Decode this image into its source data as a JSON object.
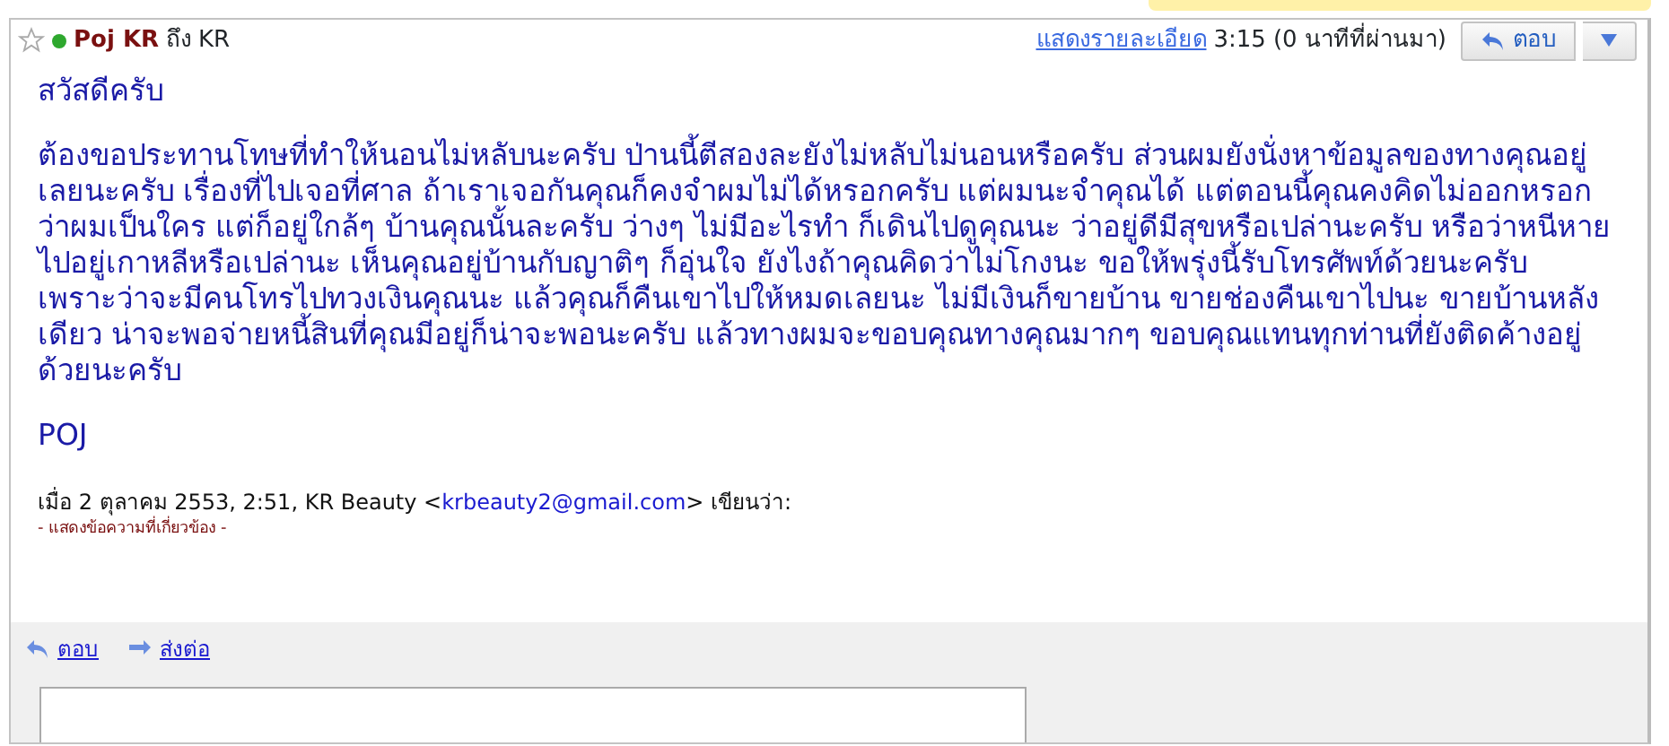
{
  "header": {
    "starred": false,
    "online": true,
    "sender": "Poj KR",
    "to_word": "ถึง",
    "recipient": "KR",
    "details_link": "แสดงรายละเอียด",
    "time": "3:15",
    "ago": "(0 นาทีที่ผ่านมา)",
    "reply_button": "ตอบ"
  },
  "message": {
    "greeting": "สวัสดีครับ",
    "body": "ต้องขอประทานโทษที่ทำให้นอนไม่หลับนะครับ ป่านนี้ตีสองละยังไม่หลับไม่นอนหรือครับ ส่วนผมยังนั่งหาข้อมูลของทางคุณอยู่เลยนะครับ เรื่องที่ไปเจอที่ศาล ถ้าเราเจอกันคุณก็คงจำผมไม่ได้หรอกครับ แต่ผมนะจำคุณได้ แต่ตอนนี้คุณคงคิดไม่ออกหรอกว่าผมเป็นใคร แต่ก็อยู่ใกล้ๆ บ้านคุณนั้นละครับ ว่างๆ ไม่มีอะไรทำ ก็เดินไปดูคุณนะ ว่าอยู่ดีมีสุขหรือเปล่านะครับ หรือว่าหนีหายไปอยู่เกาหลีหรือเปล่านะ เห็นคุณอยู่บ้านกับญาติๆ ก็อุ่นใจ ยังไงถ้าคุณคิดว่าไม่โกงนะ ขอให้พรุ่งนี้รับโทรศัพท์ด้วยนะครับ เพราะว่าจะมีคนโทรไปทวงเงินคุณนะ แล้วคุณก็คืนเขาไปให้หมดเลยนะ ไม่มีเงินก็ขายบ้าน ขายช่องคืนเขาไปนะ ขายบ้านหลังเดียว น่าจะพอจ่ายหนี้สินที่คุณมีอยู่ก็น่าจะพอนะครับ แล้วทางผมจะขอบคุณทางคุณมากๆ ขอบคุณแทนทุกท่านที่ยังติดค้างอยู่ด้วยนะครับ",
    "signature": "POJ",
    "quote_intro": "เมื่อ 2 ตุลาคม 2553, 2:51, KR Beauty <",
    "quote_email": "krbeauty2@gmail.com",
    "quote_outro": "> เขียนว่า:",
    "show_quoted": "- แสดงข้อความที่เกี่ยวข้อง -"
  },
  "footer": {
    "actions": [
      {
        "kind": "reply",
        "label": "ตอบ"
      },
      {
        "kind": "forward",
        "label": "ส่งต่อ"
      }
    ]
  }
}
